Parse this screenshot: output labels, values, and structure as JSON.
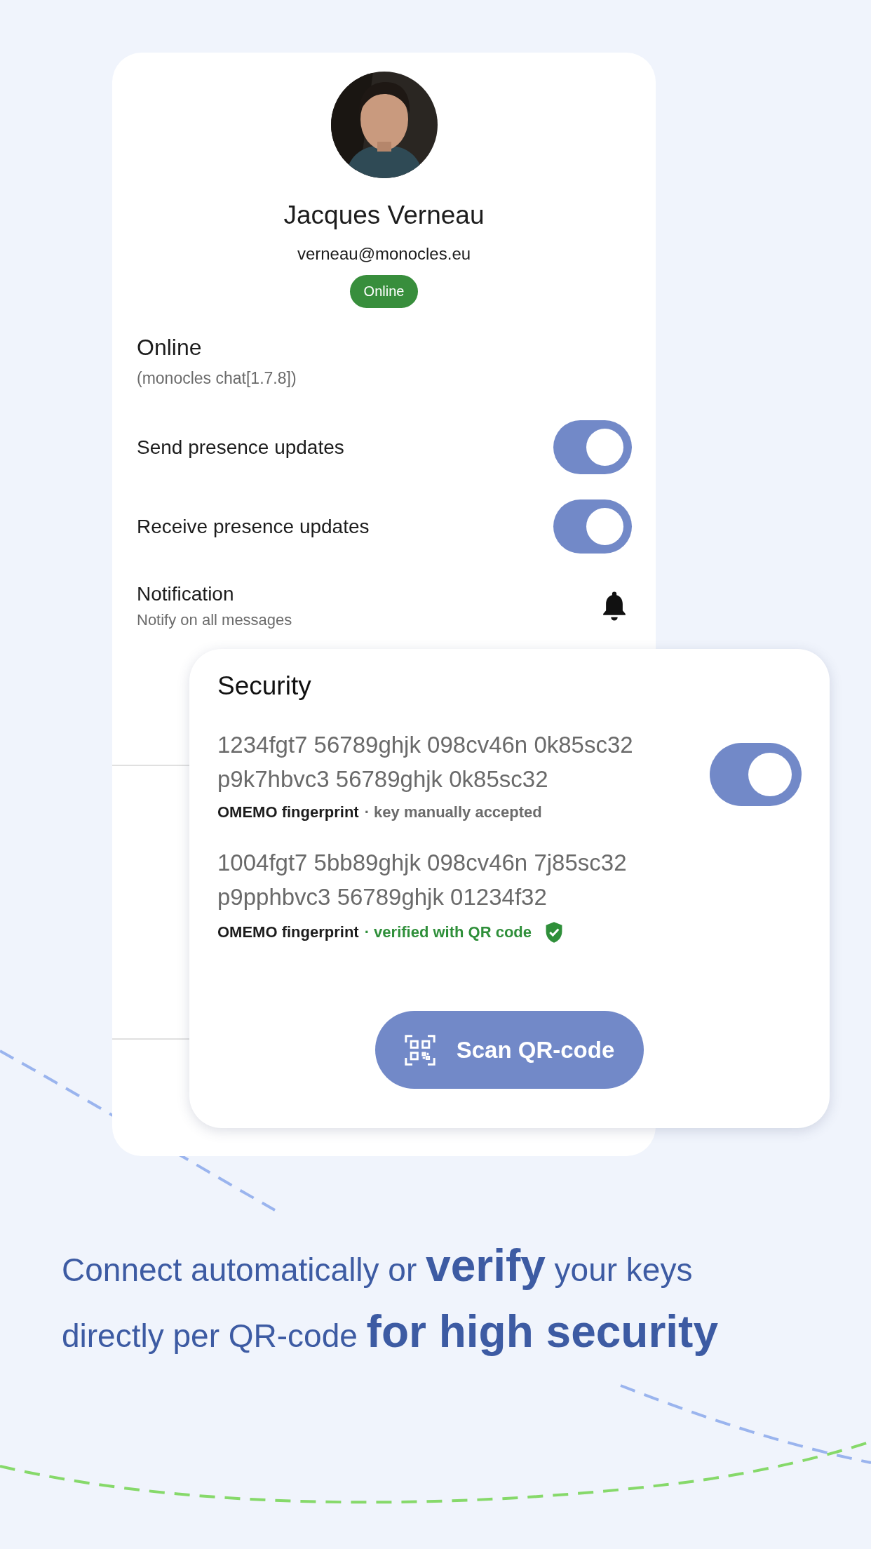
{
  "profile": {
    "name": "Jacques Verneau",
    "address": "verneau@monocles.eu",
    "status_badge": "Online"
  },
  "presence": {
    "status": "Online",
    "client": "(monocles chat[1.7.8])"
  },
  "settings": [
    {
      "kind": "toggle",
      "label": "Send presence updates",
      "on": true
    },
    {
      "kind": "toggle",
      "label": "Receive presence updates",
      "on": true
    },
    {
      "kind": "bell",
      "label": "Notification",
      "sublabel": "Notify on all messages"
    }
  ],
  "security": {
    "title": "Security",
    "keys": [
      {
        "kind": "toggle",
        "fingerprint_lines": [
          "1234fgt7 56789ghjk 098cv46n 0k85sc32",
          "p9k7hbvc3 56789ghjk 0k85sc32"
        ],
        "type": "OMEMO fingerprint",
        "status": "· key manually accepted",
        "on": true
      },
      {
        "kind": "verified",
        "fingerprint_lines": [
          "1004fgt7 5bb89ghjk 098cv46n 7j85sc32",
          "p9pphbvc3 56789ghjk 01234f32"
        ],
        "type": "OMEMO fingerprint",
        "status": "· verified with QR code"
      }
    ],
    "button": "Scan QR-code"
  },
  "tagline": "Connect automatically or **verify** your keys\ndirectly per QR-code **for high security**"
}
